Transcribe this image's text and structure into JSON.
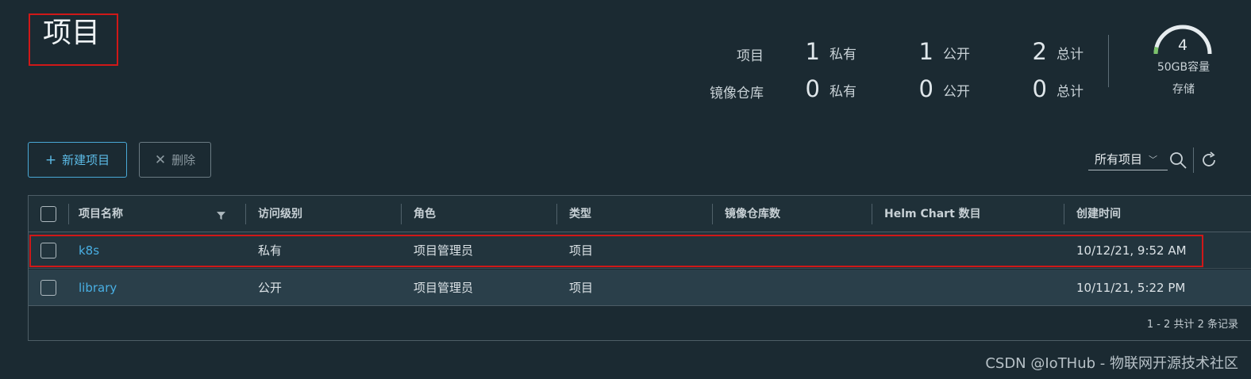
{
  "page": {
    "title": "项目"
  },
  "stats": {
    "rows": [
      {
        "label": "项目",
        "private_num": "1",
        "private_label": "私有",
        "public_num": "1",
        "public_label": "公开",
        "total_num": "2",
        "total_label": "总计"
      },
      {
        "label": "镜像仓库",
        "private_num": "0",
        "private_label": "私有",
        "public_num": "0",
        "public_label": "公开",
        "total_num": "0",
        "total_label": "总计"
      }
    ],
    "storage": {
      "value": "4",
      "capacity": "50GB容量",
      "label": "存储",
      "fill_fraction": 0.08
    }
  },
  "toolbar": {
    "new_label": "新建项目",
    "delete_label": "删除",
    "filter_value": "所有项目"
  },
  "table": {
    "columns": [
      "项目名称",
      "访问级别",
      "角色",
      "类型",
      "镜像仓库数",
      "Helm Chart 数目",
      "创建时间"
    ],
    "rows": [
      {
        "name": "k8s",
        "access": "私有",
        "role": "项目管理员",
        "type": "项目",
        "repo_count": "",
        "chart_count": "",
        "created": "10/12/21, 9:52 AM"
      },
      {
        "name": "library",
        "access": "公开",
        "role": "项目管理员",
        "type": "项目",
        "repo_count": "",
        "chart_count": "",
        "created": "10/11/21, 5:22 PM"
      }
    ],
    "footer": "1 - 2 共计 2 条记录"
  },
  "watermark": "CSDN @IoTHub - 物联网开源技术社区",
  "colors": {
    "accent": "#49afe3",
    "highlight": "#d01818",
    "background": "#1b2a32"
  }
}
